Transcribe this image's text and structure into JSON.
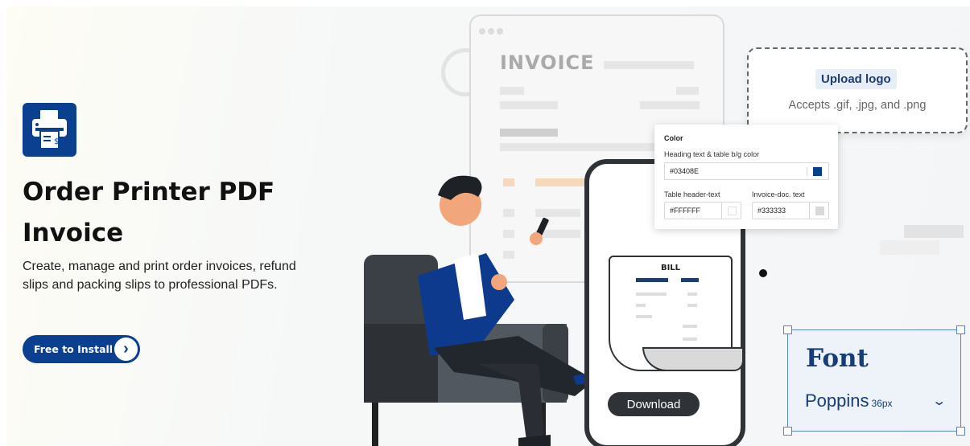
{
  "brand": {
    "accent": "#0b3f8f",
    "dark": "#2f3236",
    "font_blue": "#173d79"
  },
  "hero": {
    "title": "Order Printer PDF Invoice",
    "description": "Create, manage and print order invoices, refund slips and packing slips to professional PDFs.",
    "install_label": "Free to Install",
    "install_icon": "chevron-right-icon",
    "app_icon": "printer-invoice-icon"
  },
  "invoice_mock": {
    "title": "INVOICE"
  },
  "upload": {
    "button_label": "Upload logo",
    "note": "Accepts .gif, .jpg, and .png"
  },
  "color_panel": {
    "heading": "Color",
    "heading_color_label": "Heading text & table b/g color",
    "heading_color_value": "#03408E",
    "table_header_label": "Table header-text",
    "table_header_value": "#FFFFFF",
    "invoice_doc_label": "Invoice-doc. text",
    "invoice_doc_value": "#333333"
  },
  "phone": {
    "bill_title": "BILL",
    "download_label": "Download"
  },
  "font_card": {
    "title": "Font",
    "font_name": "Poppins",
    "font_size": "36px",
    "dropdown_icon": "chevron-down-icon"
  }
}
